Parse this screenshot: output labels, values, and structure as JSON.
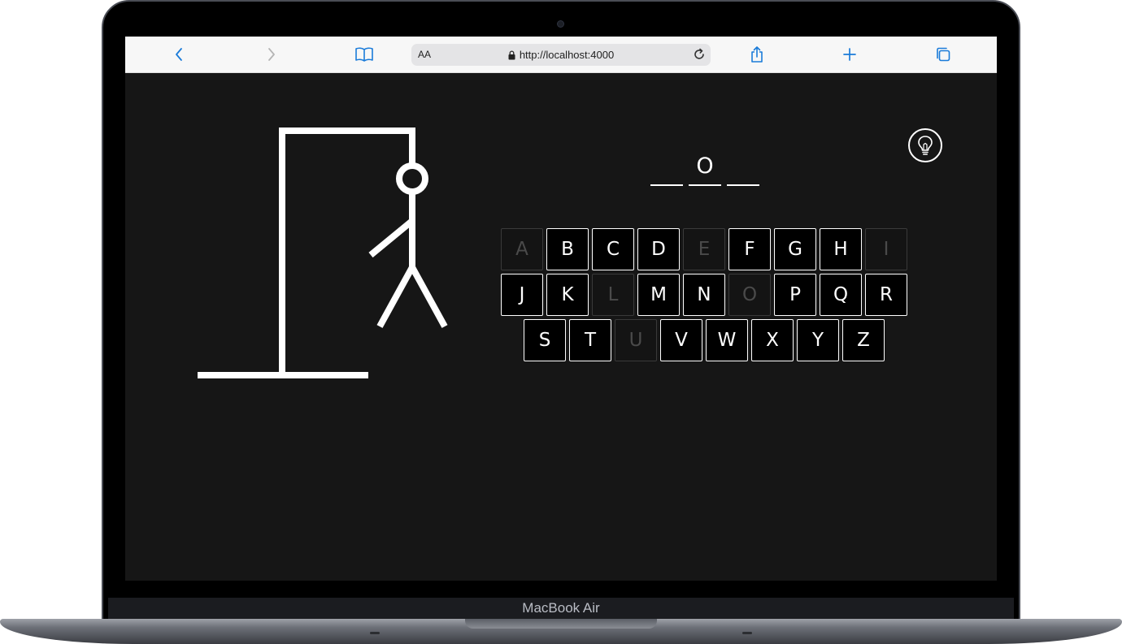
{
  "device": {
    "label": "MacBook Air"
  },
  "browser": {
    "text_size_label": "AA",
    "url": "http://localhost:4000",
    "icons": {
      "back": "chevron-left-icon",
      "forward": "chevron-right-icon",
      "bookmarks": "book-icon",
      "lock": "lock-icon",
      "reload": "reload-icon",
      "share": "share-icon",
      "new_tab": "plus-icon",
      "tabs": "tabs-icon"
    },
    "accent_color": "#1a7bd9"
  },
  "game": {
    "background_color": "#161616",
    "hint_icon": "lightbulb-icon",
    "word_slots": [
      "",
      "O",
      ""
    ],
    "keyboard": {
      "rows": [
        [
          {
            "letter": "A",
            "used": true
          },
          {
            "letter": "B",
            "used": false
          },
          {
            "letter": "C",
            "used": false
          },
          {
            "letter": "D",
            "used": false
          },
          {
            "letter": "E",
            "used": true
          },
          {
            "letter": "F",
            "used": false
          },
          {
            "letter": "G",
            "used": false
          },
          {
            "letter": "H",
            "used": false
          },
          {
            "letter": "I",
            "used": true
          }
        ],
        [
          {
            "letter": "J",
            "used": false
          },
          {
            "letter": "K",
            "used": false
          },
          {
            "letter": "L",
            "used": true
          },
          {
            "letter": "M",
            "used": false
          },
          {
            "letter": "N",
            "used": false
          },
          {
            "letter": "O",
            "used": true
          },
          {
            "letter": "P",
            "used": false
          },
          {
            "letter": "Q",
            "used": false
          },
          {
            "letter": "R",
            "used": false
          }
        ],
        [
          {
            "letter": "S",
            "used": false
          },
          {
            "letter": "T",
            "used": false
          },
          {
            "letter": "U",
            "used": true
          },
          {
            "letter": "V",
            "used": false
          },
          {
            "letter": "W",
            "used": false
          },
          {
            "letter": "X",
            "used": false
          },
          {
            "letter": "Y",
            "used": false
          },
          {
            "letter": "Z",
            "used": false
          }
        ]
      ]
    },
    "hangman_parts_visible": [
      "base",
      "pole",
      "beam",
      "rope",
      "head",
      "body",
      "left-arm",
      "left-leg",
      "right-leg"
    ]
  }
}
